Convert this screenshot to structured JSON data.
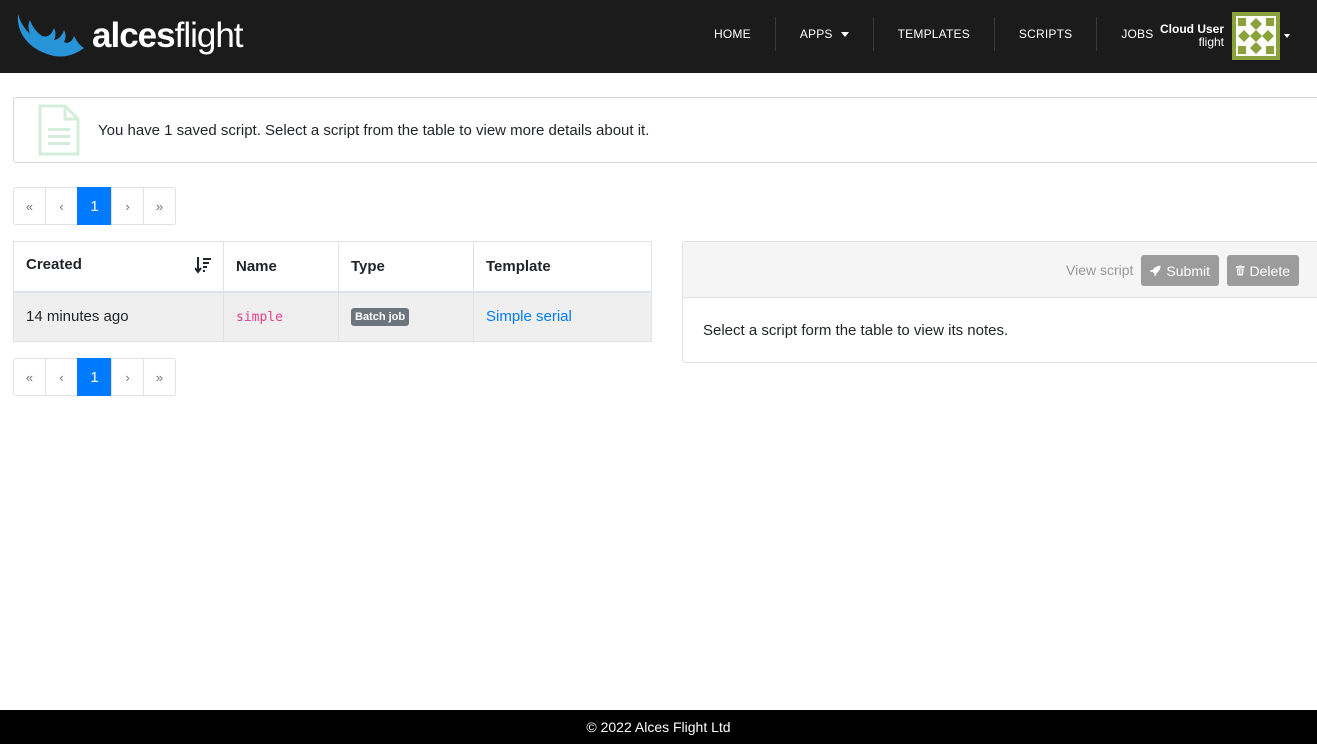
{
  "brand": {
    "bold": "alces",
    "light": "flight",
    "icon": "antler-logo-icon",
    "color": "#2794d8"
  },
  "nav": {
    "home": "HOME",
    "apps": "APPS",
    "templates": "TEMPLATES",
    "scripts": "SCRIPTS",
    "jobs": "JOBS"
  },
  "user": {
    "name": "Cloud User",
    "username": "flight"
  },
  "info": {
    "message": "You have 1 saved script. Select a script from the table to view more details about it.",
    "icon": "document-icon"
  },
  "pagination": {
    "first": "«",
    "prev": "‹",
    "current": "1",
    "next": "›",
    "last": "»"
  },
  "table": {
    "headers": {
      "created": "Created",
      "name": "Name",
      "type": "Type",
      "template": "Template"
    },
    "rows": [
      {
        "created": "14 minutes ago",
        "name": "simple",
        "type": "Batch job",
        "template": "Simple serial"
      }
    ]
  },
  "card": {
    "view_script": "View script",
    "submit": "Submit",
    "delete": "Delete",
    "body": "Select a script form the table to view its notes."
  },
  "footer": {
    "text": "© 2022 Alces Flight Ltd"
  },
  "colors": {
    "navbar": "#1b1b1b",
    "accent": "#007bff",
    "muted_button": "#9c9c9c",
    "code": "#e83e8c"
  }
}
